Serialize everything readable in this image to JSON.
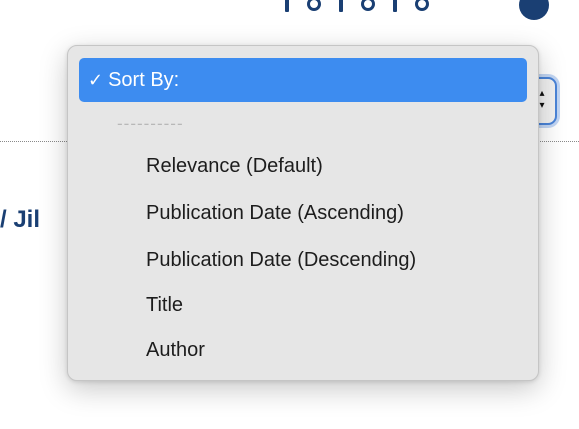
{
  "heading": {
    "fragment": "/ Jil"
  },
  "sort": {
    "selected_label": "Sort By:",
    "checkmark": "✓",
    "separator": "----------",
    "options": [
      "Relevance (Default)",
      "Publication Date (Ascending)",
      "Publication Date (Descending)",
      "Title",
      "Author"
    ]
  },
  "colors": {
    "accent": "#3d8cf0",
    "heading": "#1a3f73",
    "menu_bg": "#e6e6e6"
  }
}
